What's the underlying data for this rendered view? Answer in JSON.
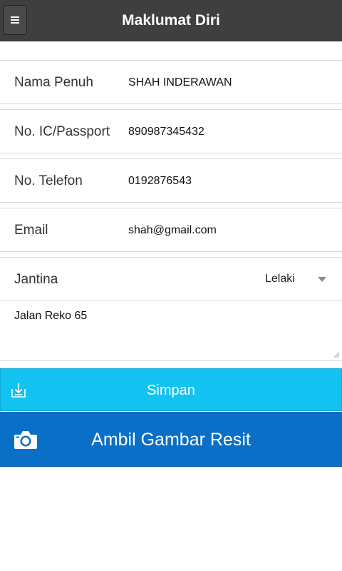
{
  "header": {
    "title": "Maklumat Diri",
    "menu_icon": "hamburger-menu-icon"
  },
  "form": {
    "fields": [
      {
        "label": "Nama Penuh",
        "value": "SHAH INDERAWAN"
      },
      {
        "label": "No. IC/Passport",
        "value": "890987345432"
      },
      {
        "label": "No. Telefon",
        "value": "0192876543"
      },
      {
        "label": "Email",
        "value": "shah@gmail.com"
      }
    ],
    "gender": {
      "label": "Jantina",
      "selected": "Lelaki"
    },
    "address": "Jalan Reko 65"
  },
  "actions": {
    "save_label": "Simpan",
    "save_icon": "download-icon",
    "photo_label": "Ambil Gambar Resit",
    "photo_icon": "camera-icon"
  },
  "colors": {
    "header_bg": "#3f3f3f",
    "save_bg": "#12c3f2",
    "photo_bg": "#0a6fc7"
  }
}
